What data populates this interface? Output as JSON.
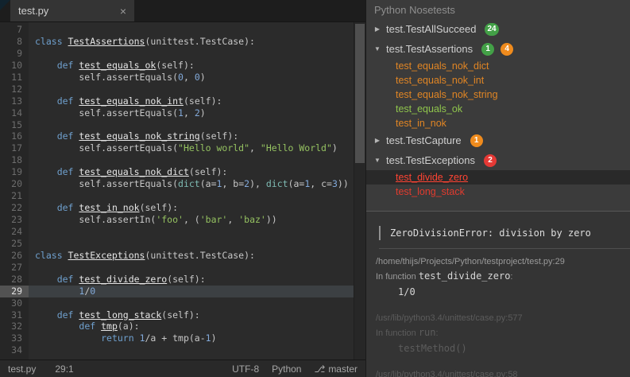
{
  "colors": {
    "badge_green": "#43a047",
    "badge_orange": "#ef8b1d",
    "badge_red": "#e53935",
    "test_green": "#8fc54c",
    "test_orange": "#e08524",
    "test_red": "#e23b2e",
    "test_red_selected": "#ff4433"
  },
  "tabbar": {
    "tabs": [
      {
        "label": "test.py",
        "active": true
      }
    ],
    "close_glyph": "×"
  },
  "editor": {
    "first_line": 7,
    "current_line": 29,
    "lines": [
      [],
      [
        [
          "class ",
          "kw"
        ],
        [
          "TestAssertions",
          "fn"
        ],
        [
          "(unittest.TestCase):",
          "pl"
        ]
      ],
      [],
      [
        [
          "    ",
          "pl"
        ],
        [
          "def ",
          "kw"
        ],
        [
          "test_equals_ok",
          "fn"
        ],
        [
          "(self):",
          "pl"
        ]
      ],
      [
        [
          "        self.assertEquals(",
          "pl"
        ],
        [
          "0",
          "num"
        ],
        [
          ", ",
          "pl"
        ],
        [
          "0",
          "num"
        ],
        [
          ")",
          "pl"
        ]
      ],
      [],
      [
        [
          "    ",
          "pl"
        ],
        [
          "def ",
          "kw"
        ],
        [
          "test_equals_nok_int",
          "fn"
        ],
        [
          "(self):",
          "pl"
        ]
      ],
      [
        [
          "        self.assertEquals(",
          "pl"
        ],
        [
          "1",
          "num"
        ],
        [
          ", ",
          "pl"
        ],
        [
          "2",
          "num"
        ],
        [
          ")",
          "pl"
        ]
      ],
      [],
      [
        [
          "    ",
          "pl"
        ],
        [
          "def ",
          "kw"
        ],
        [
          "test_equals_nok_string",
          "fn"
        ],
        [
          "(self):",
          "pl"
        ]
      ],
      [
        [
          "        self.assertEquals(",
          "pl"
        ],
        [
          "\"Hello world\"",
          "str"
        ],
        [
          ", ",
          "pl"
        ],
        [
          "\"Hello World\"",
          "str"
        ],
        [
          ")",
          "pl"
        ]
      ],
      [],
      [
        [
          "    ",
          "pl"
        ],
        [
          "def ",
          "kw"
        ],
        [
          "test_equals_nok_dict",
          "fn"
        ],
        [
          "(self):",
          "pl"
        ]
      ],
      [
        [
          "        self.assertEquals(",
          "pl"
        ],
        [
          "dict",
          "bi"
        ],
        [
          "(a=",
          "pl"
        ],
        [
          "1",
          "num"
        ],
        [
          ", b=",
          "pl"
        ],
        [
          "2",
          "num"
        ],
        [
          "), ",
          "pl"
        ],
        [
          "dict",
          "bi"
        ],
        [
          "(a=",
          "pl"
        ],
        [
          "1",
          "num"
        ],
        [
          ", c=",
          "pl"
        ],
        [
          "3",
          "num"
        ],
        [
          "))",
          "pl"
        ]
      ],
      [],
      [
        [
          "    ",
          "pl"
        ],
        [
          "def ",
          "kw"
        ],
        [
          "test_in_nok",
          "fn"
        ],
        [
          "(self):",
          "pl"
        ]
      ],
      [
        [
          "        self.assertIn(",
          "pl"
        ],
        [
          "'foo'",
          "str"
        ],
        [
          ", (",
          "pl"
        ],
        [
          "'bar'",
          "str"
        ],
        [
          ", ",
          "pl"
        ],
        [
          "'baz'",
          "str"
        ],
        [
          "))",
          "pl"
        ]
      ],
      [],
      [],
      [
        [
          "class ",
          "kw"
        ],
        [
          "TestExceptions",
          "fn"
        ],
        [
          "(unittest.TestCase):",
          "pl"
        ]
      ],
      [],
      [
        [
          "    ",
          "pl"
        ],
        [
          "def ",
          "kw"
        ],
        [
          "test_divide_zero",
          "fn"
        ],
        [
          "(self):",
          "pl"
        ]
      ],
      [
        [
          "        ",
          "pl"
        ],
        [
          "1",
          "num"
        ],
        [
          "/",
          "pl"
        ],
        [
          "0",
          "num"
        ]
      ],
      [],
      [
        [
          "    ",
          "pl"
        ],
        [
          "def ",
          "kw"
        ],
        [
          "test_long_stack",
          "fn"
        ],
        [
          "(self):",
          "pl"
        ]
      ],
      [
        [
          "        ",
          "pl"
        ],
        [
          "def ",
          "kw"
        ],
        [
          "tmp",
          "fn"
        ],
        [
          "(a):",
          "pl"
        ]
      ],
      [
        [
          "            ",
          "pl"
        ],
        [
          "return ",
          "kw"
        ],
        [
          "1",
          "num"
        ],
        [
          "/a + tmp(a-",
          "pl"
        ],
        [
          "1",
          "num"
        ],
        [
          ")",
          "pl"
        ]
      ],
      []
    ]
  },
  "statusbar": {
    "file": "test.py",
    "position": "29:1",
    "encoding": "UTF-8",
    "language": "Python",
    "branch_icon": "⎇",
    "branch": "master"
  },
  "tests_panel": {
    "title": "Python Nosetests",
    "collapsed_icon": "▶",
    "expanded_icon": "▼",
    "groups": [
      {
        "label": "test.TestAllSucceed",
        "expanded": false,
        "badges": [
          {
            "count": "24",
            "color": "green"
          }
        ],
        "children": []
      },
      {
        "label": "test.TestAssertions",
        "expanded": true,
        "badges": [
          {
            "count": "1",
            "color": "green"
          },
          {
            "count": "4",
            "color": "orange"
          }
        ],
        "children": [
          {
            "label": "test_equals_nok_dict",
            "status": "orange",
            "selected": false
          },
          {
            "label": "test_equals_nok_int",
            "status": "orange",
            "selected": false
          },
          {
            "label": "test_equals_nok_string",
            "status": "orange",
            "selected": false
          },
          {
            "label": "test_equals_ok",
            "status": "green",
            "selected": false
          },
          {
            "label": "test_in_nok",
            "status": "orange",
            "selected": false
          }
        ]
      },
      {
        "label": "test.TestCapture",
        "expanded": false,
        "badges": [
          {
            "count": "1",
            "color": "orange"
          }
        ],
        "children": []
      },
      {
        "label": "test.TestExceptions",
        "expanded": true,
        "badges": [
          {
            "count": "2",
            "color": "red"
          }
        ],
        "children": [
          {
            "label": "test_divide_zero",
            "status": "red",
            "selected": true
          },
          {
            "label": "test_long_stack",
            "status": "red",
            "selected": false
          }
        ]
      }
    ]
  },
  "details": {
    "error": "ZeroDivisionError: division by zero",
    "frames": [
      {
        "location": "/home/thijs/Projects/Python/testproject/test.py:29",
        "context_prefix": "In function ",
        "function": "test_divide_zero",
        "context_suffix": ":",
        "code": "1/0",
        "dimmed": false
      },
      {
        "location": "/usr/lib/python3.4/unittest/case.py:577",
        "context_prefix": "In function ",
        "function": "run",
        "context_suffix": ":",
        "code": "testMethod()",
        "dimmed": true
      },
      {
        "location": "/usr/lib/python3.4/unittest/case.py:58",
        "context_prefix": "",
        "function": "",
        "context_suffix": "",
        "code": "",
        "dimmed": true
      }
    ]
  }
}
